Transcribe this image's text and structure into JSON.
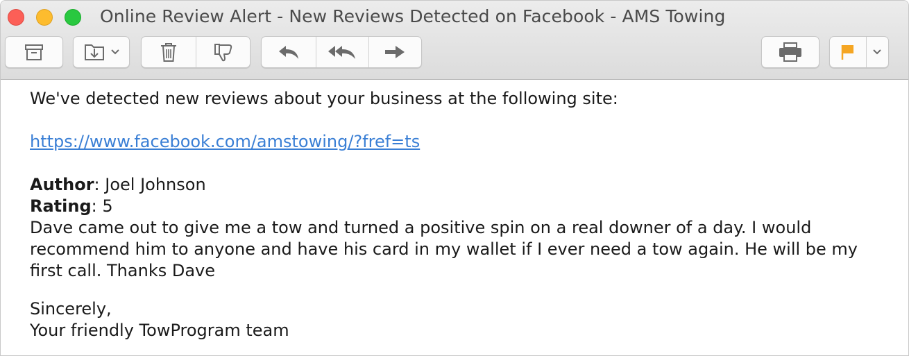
{
  "window": {
    "title": "Online Review Alert - New Reviews Detected on Facebook - AMS Towing"
  },
  "toolbar": {
    "archive": "archive-icon",
    "move": "move-to-icon",
    "trash": "trash-icon",
    "junk": "thumbs-down-icon",
    "reply": "reply-icon",
    "reply_all": "reply-all-icon",
    "forward": "forward-icon",
    "print": "print-icon",
    "flag": "flag-icon",
    "flag_color": "#f5a623"
  },
  "message": {
    "intro": "We've detected new reviews about your business at the following site:",
    "link": "https://www.facebook.com/amstowing/?fref=ts",
    "author_label": "Author",
    "author_value": ": Joel Johnson",
    "rating_label": "Rating",
    "rating_value": ": 5",
    "review_text": "Dave came out to give me a tow and turned a positive spin on a real downer of a day. I would recommend him to anyone and have his card in my wallet if I ever need a tow again. He will be my first call. Thanks Dave",
    "closing": "Sincerely,",
    "signature": "Your friendly TowProgram team"
  }
}
